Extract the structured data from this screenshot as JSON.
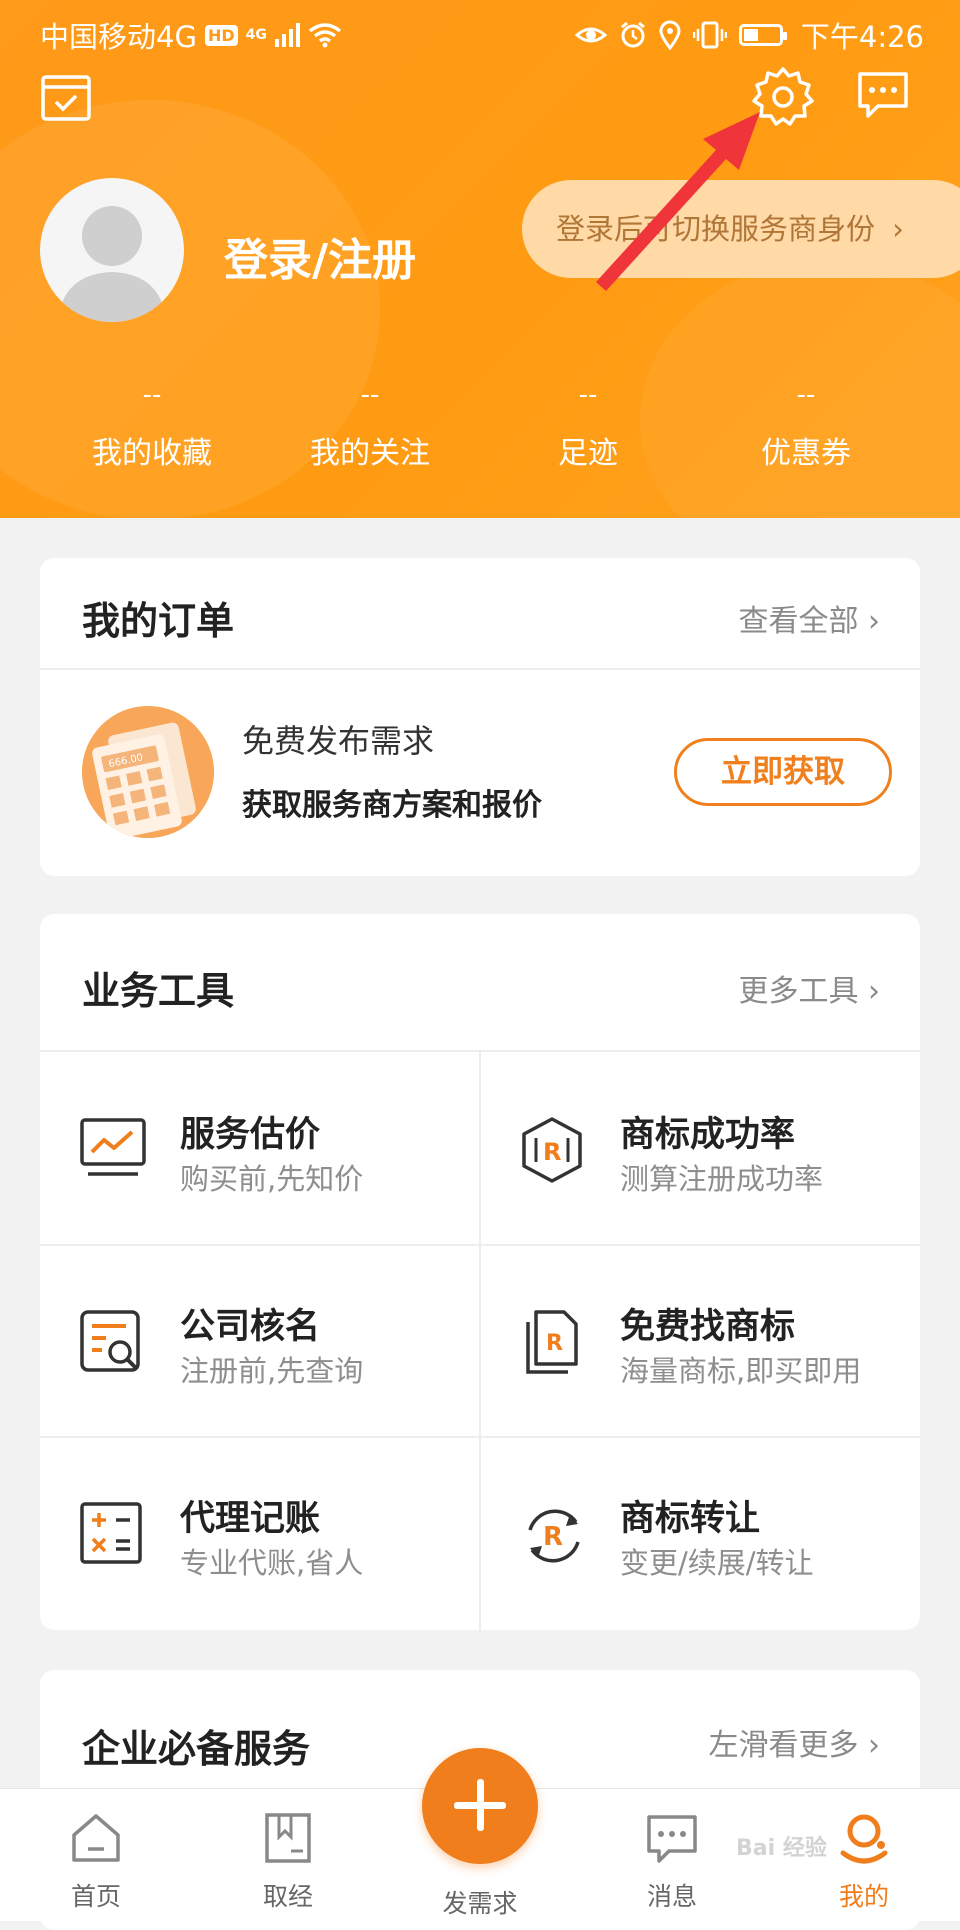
{
  "status_bar": {
    "carrier": "中国移动4G",
    "hd": "HD",
    "net": "4G",
    "time": "下午4:26"
  },
  "profile": {
    "login_label": "登录/注册",
    "switch_hint": "登录后可切换服务商身份",
    "switch_chevron": "›"
  },
  "stats": [
    {
      "value": "--",
      "label": "我的收藏"
    },
    {
      "value": "--",
      "label": "我的关注"
    },
    {
      "value": "--",
      "label": "足迹"
    },
    {
      "value": "--",
      "label": "优惠券"
    }
  ],
  "orders": {
    "title": "我的订单",
    "more": "查看全部",
    "promo_title": "免费发布需求",
    "promo_sub": "获取服务商方案和报价",
    "button": "立即获取",
    "thumb_text": "666.00"
  },
  "tools": {
    "title": "业务工具",
    "more": "更多工具",
    "items": [
      {
        "name": "服务估价",
        "desc": "购买前,先知价",
        "icon": "price-chart-icon"
      },
      {
        "name": "商标成功率",
        "desc": "测算注册成功率",
        "icon": "trademark-hexagon-icon"
      },
      {
        "name": "公司核名",
        "desc": "注册前,先查询",
        "icon": "document-search-icon"
      },
      {
        "name": "免费找商标",
        "desc": "海量商标,即买即用",
        "icon": "trademark-document-icon"
      },
      {
        "name": "代理记账",
        "desc": "专业代账,省人",
        "icon": "calculator-icon"
      },
      {
        "name": "商标转让",
        "desc": "变更/续展/转让",
        "icon": "trademark-transfer-icon"
      }
    ]
  },
  "services": {
    "title": "企业必备服务",
    "more": "左滑看更多"
  },
  "nav": {
    "home": "首页",
    "learn": "取经",
    "post": "发需求",
    "messages": "消息",
    "mine": "我的"
  },
  "watermark": "Bai 经验",
  "colors": {
    "header": "#ff9a1a",
    "accent": "#f07e1d",
    "text": "#222222",
    "muted": "#8e8e8e"
  }
}
